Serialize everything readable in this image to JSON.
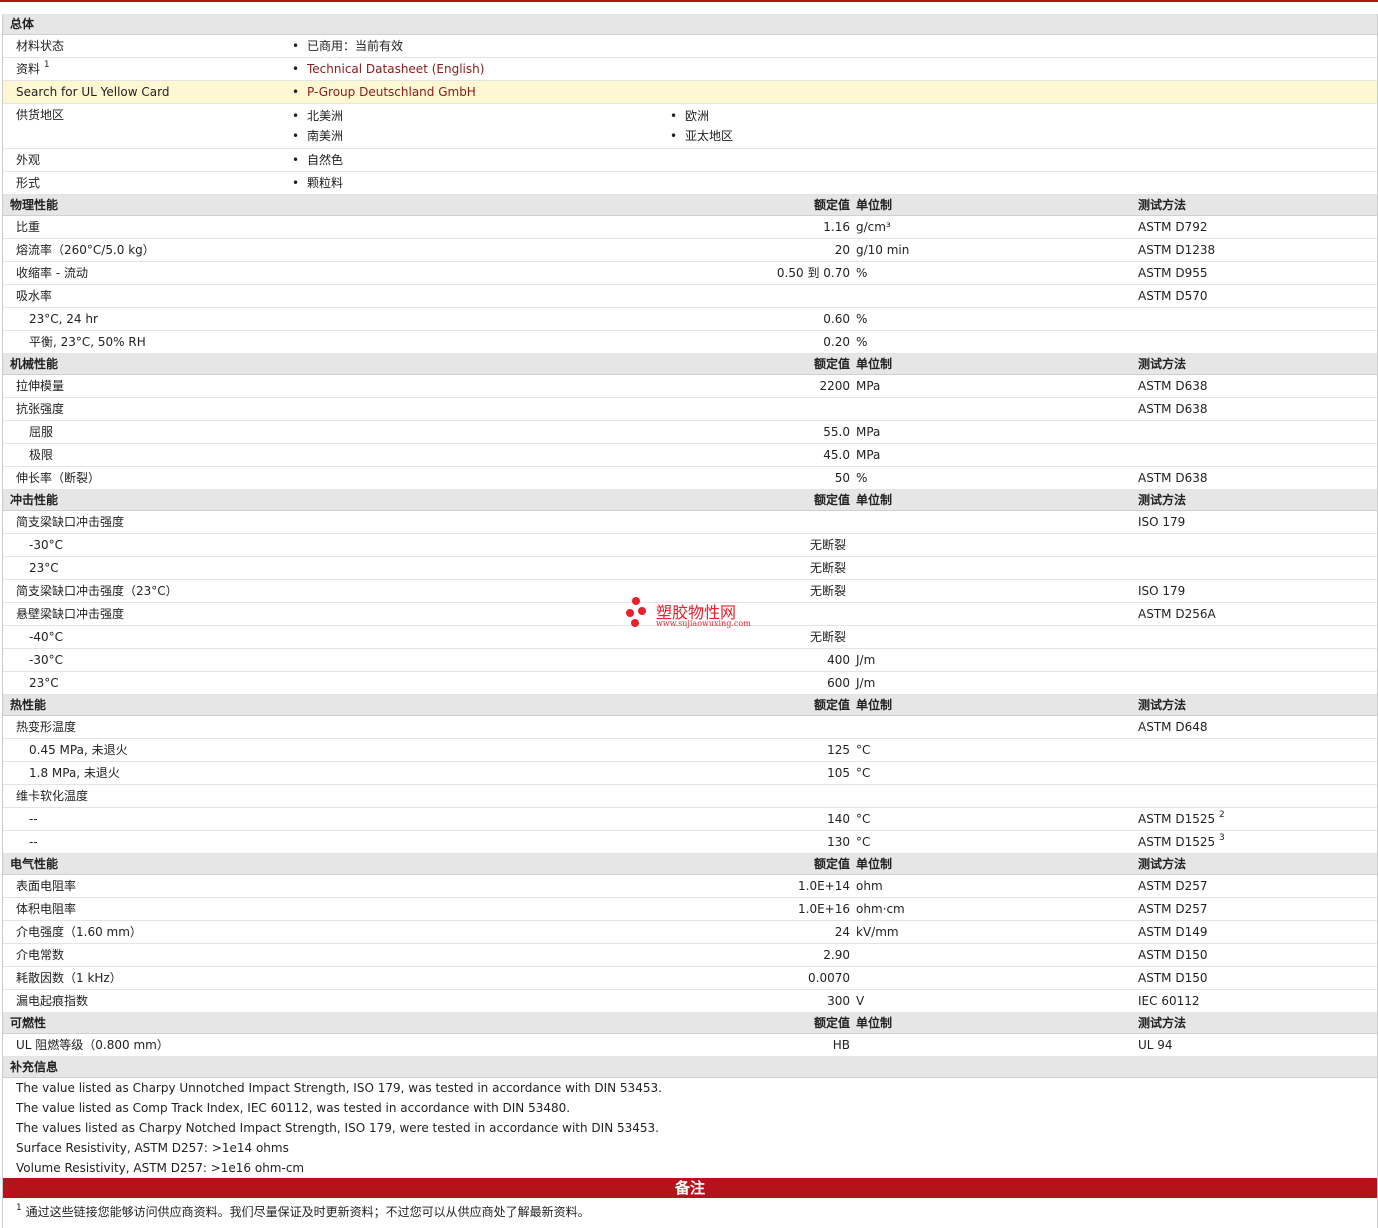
{
  "general": {
    "title": "总体",
    "rows": [
      {
        "label": "材料状态",
        "value": "已商用：当前有效"
      },
      {
        "label": "资料",
        "sup": "1",
        "value": "Technical Datasheet (English)"
      },
      {
        "label": "Search for UL Yellow Card",
        "value": "P-Group Deutschland GmbH"
      }
    ],
    "supply": {
      "label": "供货地区",
      "values": [
        "北美洲",
        "欧洲",
        "南美洲",
        "亚太地区"
      ]
    },
    "rows2": [
      {
        "label": "外观",
        "value": "自然色"
      },
      {
        "label": "形式",
        "value": "颗粒料"
      }
    ]
  },
  "headers": {
    "nominal": "额定值",
    "unit": "单位制",
    "method": "测试方法"
  },
  "sections": [
    {
      "title": "物理性能",
      "rows": [
        {
          "label": "比重",
          "value": "1.16",
          "unit": "g/cm³",
          "method": "ASTM D792"
        },
        {
          "label": "熔流率（260°C/5.0 kg）",
          "value": "20",
          "unit": "g/10 min",
          "method": "ASTM D1238"
        },
        {
          "label": "收缩率 - 流动",
          "value": "0.50 到 0.70",
          "unit": "%",
          "method": "ASTM D955"
        },
        {
          "label": "吸水率",
          "value": "",
          "unit": "",
          "method": "ASTM D570"
        },
        {
          "label": "23°C, 24 hr",
          "sub": true,
          "value": "0.60",
          "unit": "%",
          "method": ""
        },
        {
          "label": "平衡, 23°C, 50% RH",
          "sub": true,
          "value": "0.20",
          "unit": "%",
          "method": ""
        }
      ]
    },
    {
      "title": "机械性能",
      "rows": [
        {
          "label": "拉伸模量",
          "value": "2200",
          "unit": "MPa",
          "method": "ASTM D638"
        },
        {
          "label": "抗张强度",
          "value": "",
          "unit": "",
          "method": "ASTM D638"
        },
        {
          "label": "屈服",
          "sub": true,
          "value": "55.0",
          "unit": "MPa",
          "method": ""
        },
        {
          "label": "极限",
          "sub": true,
          "value": "45.0",
          "unit": "MPa",
          "method": ""
        },
        {
          "label": "伸长率（断裂）",
          "value": "50",
          "unit": "%",
          "method": "ASTM D638"
        }
      ]
    },
    {
      "title": "冲击性能",
      "rows": [
        {
          "label": "简支梁缺口冲击强度",
          "value": "",
          "unit": "",
          "method": "ISO 179"
        },
        {
          "label": "-30°C",
          "sub": true,
          "text": "无断裂",
          "method": ""
        },
        {
          "label": "23°C",
          "sub": true,
          "text": "无断裂",
          "method": ""
        },
        {
          "label": "简支梁缺口冲击强度（23°C）",
          "text": "无断裂",
          "method": "ISO 179"
        },
        {
          "label": "悬壁梁缺口冲击强度",
          "value": "",
          "unit": "",
          "method": "ASTM D256A"
        },
        {
          "label": "-40°C",
          "sub": true,
          "text": "无断裂",
          "method": ""
        },
        {
          "label": "-30°C",
          "sub": true,
          "value": "400",
          "unit": "J/m",
          "method": ""
        },
        {
          "label": "23°C",
          "sub": true,
          "value": "600",
          "unit": "J/m",
          "method": ""
        }
      ]
    },
    {
      "title": "热性能",
      "rows": [
        {
          "label": "热变形温度",
          "value": "",
          "unit": "",
          "method": "ASTM D648"
        },
        {
          "label": "0.45 MPa, 未退火",
          "sub": true,
          "value": "125",
          "unit": "°C",
          "method": ""
        },
        {
          "label": "1.8 MPa, 未退火",
          "sub": true,
          "value": "105",
          "unit": "°C",
          "method": ""
        },
        {
          "label": "维卡软化温度",
          "value": "",
          "unit": "",
          "method": ""
        },
        {
          "label": "--",
          "sub": true,
          "value": "140",
          "unit": "°C",
          "method": "ASTM D1525",
          "msup": "2"
        },
        {
          "label": "--",
          "sub": true,
          "value": "130",
          "unit": "°C",
          "method": "ASTM D1525",
          "msup": "3"
        }
      ]
    },
    {
      "title": "电气性能",
      "rows": [
        {
          "label": "表面电阻率",
          "value": "1.0E+14",
          "unit": "ohm",
          "method": "ASTM D257"
        },
        {
          "label": "体积电阻率",
          "value": "1.0E+16",
          "unit": "ohm·cm",
          "method": "ASTM D257"
        },
        {
          "label": "介电强度（1.60 mm）",
          "value": "24",
          "unit": "kV/mm",
          "method": "ASTM D149"
        },
        {
          "label": "介电常数",
          "value": "2.90",
          "unit": "",
          "method": "ASTM D150"
        },
        {
          "label": "耗散因数（1 kHz）",
          "value": "0.0070",
          "unit": "",
          "method": "ASTM D150"
        },
        {
          "label": "漏电起痕指数",
          "value": "300",
          "unit": "V",
          "method": "IEC 60112"
        }
      ]
    },
    {
      "title": "可燃性",
      "rows": [
        {
          "label": "UL 阻燃等级（0.800 mm）",
          "value": "HB",
          "unit": "",
          "method": "UL 94"
        }
      ]
    }
  ],
  "supplement": {
    "title": "补充信息",
    "lines": [
      "The value listed as Charpy Unnotched Impact Strength, ISO 179, was tested in accordance with DIN 53453.",
      "The value listed as Comp Track Index, IEC 60112, was tested in accordance with DIN 53480.",
      "The values listed as Charpy Notched Impact Strength, ISO 179, were tested in accordance with DIN 53453.",
      "Surface Resistivity, ASTM D257: >1e14 ohms",
      "Volume Resistivity, ASTM D257: >1e16 ohm-cm"
    ]
  },
  "notes": {
    "title": "备注",
    "footnotes": [
      {
        "num": "1",
        "text": "通过这些链接您能够访问供应商资料。我们尽量保证及时更新资料；不过您可以从供应商处了解最新资料。"
      }
    ]
  },
  "watermark": {
    "name": "塑胶物性网",
    "url": "www.sujiaowuxing.com"
  },
  "colors": {
    "accent": "#b5121b",
    "link": "#8b1a1a",
    "highlight": "#fdf8d1",
    "section": "#e6e6e6"
  }
}
